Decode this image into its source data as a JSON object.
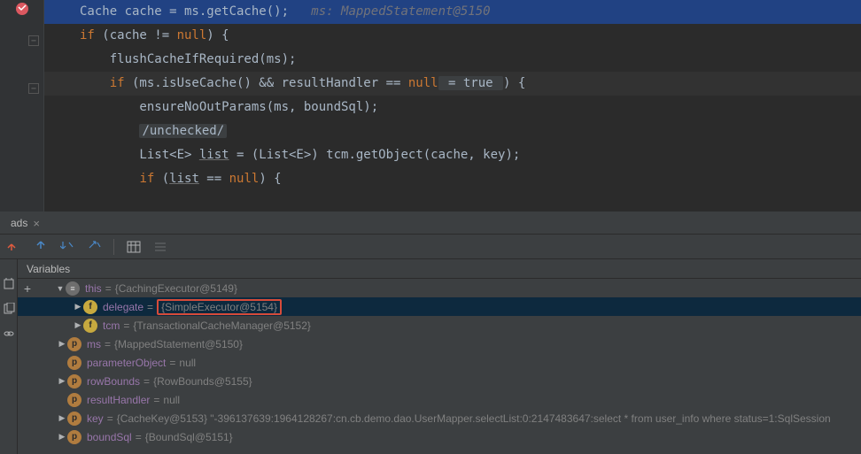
{
  "editor": {
    "lines": {
      "l1": {
        "pre": "Cache cache = ms.getCache();",
        "hint": "   ms: MappedStatement@5150"
      },
      "l2": {
        "kw": "if",
        "cond": " (cache != ",
        "nullkw": "null",
        "rest": ") {"
      },
      "l3": {
        "text": "    flushCacheIfRequired(ms);"
      },
      "l4": {
        "kw": "if",
        "mid": " (ms.isUseCache() && resultHandler == ",
        "nullkw": "null",
        "badge": " = true ",
        "rest": ") {"
      },
      "l5": {
        "text": "        ensureNoOutParams(ms, boundSql);"
      },
      "l6": {
        "badge": "/unchecked/"
      },
      "l7": {
        "pre": "        List<E> ",
        "u": "list",
        "mid": " = (List<E>) tcm.getObject(cache, key);"
      },
      "l8": {
        "kw": "if",
        "pre": " (",
        "u": "list",
        "mid": " == ",
        "nullkw": "null",
        "rest": ") {"
      }
    }
  },
  "tab": {
    "label": "ads",
    "close": "×"
  },
  "varsHeader": "Variables",
  "tree": {
    "row0": {
      "name": "this",
      "val": "{CachingExecutor@5149}",
      "indent": 60
    },
    "row1": {
      "name": "delegate",
      "val": "{SimpleExecutor@5154}",
      "indent": 78
    },
    "row2": {
      "name": "tcm",
      "val": "{TransactionalCacheManager@5152}",
      "indent": 78
    },
    "row3": {
      "name": "ms",
      "val": "{MappedStatement@5150}",
      "indent": 60
    },
    "row4": {
      "name": "parameterObject",
      "val": "null",
      "indent": 60
    },
    "row5": {
      "name": "rowBounds",
      "val": "{RowBounds@5155}",
      "indent": 60
    },
    "row6": {
      "name": "resultHandler",
      "val": "null",
      "indent": 60
    },
    "row7": {
      "name": "key",
      "val": "{CacheKey@5153} \"-396137639:1964128267:cn.cb.demo.dao.UserMapper.selectList:0:2147483647:select * from user_info where status=1:SqlSession",
      "indent": 60
    },
    "row8": {
      "name": "boundSql",
      "val": "{BoundSql@5151}",
      "indent": 60
    }
  }
}
